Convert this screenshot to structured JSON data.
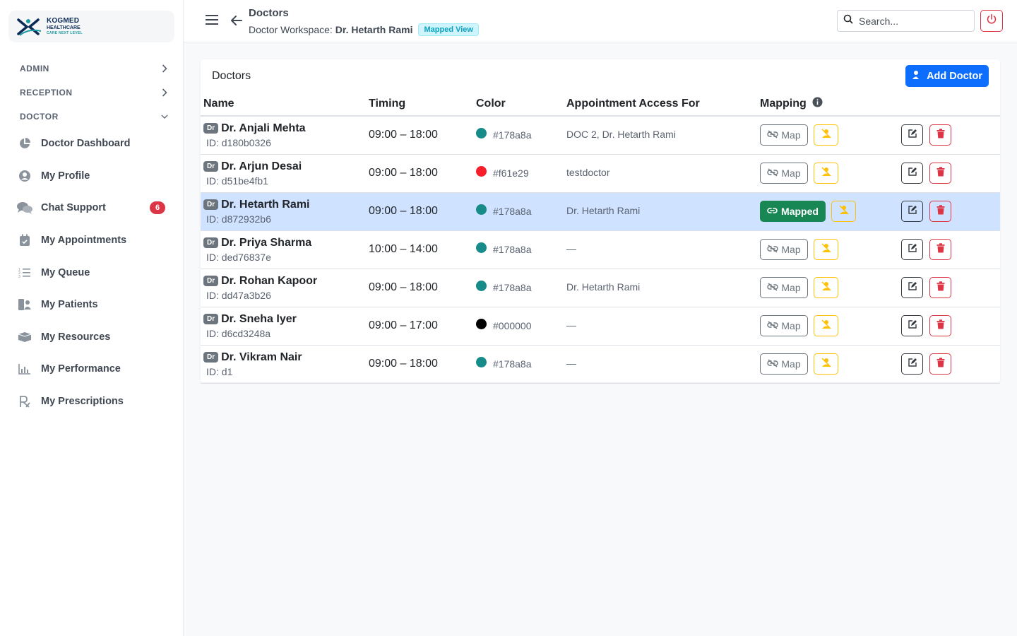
{
  "brand": {
    "name": "KOGMED",
    "sub": "HEALTHCARE",
    "tagline": "CARE NEXT LEVEL"
  },
  "sidebar": {
    "sections": [
      {
        "label": "ADMIN",
        "icon": "chevron-right-icon"
      },
      {
        "label": "RECEPTION",
        "icon": "chevron-right-icon"
      },
      {
        "label": "DOCTOR",
        "icon": "chevron-down-icon"
      }
    ],
    "items": [
      {
        "label": "Doctor Dashboard",
        "icon": "pie-chart-icon"
      },
      {
        "label": "My Profile",
        "icon": "user-circle-icon"
      },
      {
        "label": "Chat Support",
        "icon": "chat-icon",
        "badge": "6"
      },
      {
        "label": "My Appointments",
        "icon": "calendar-icon"
      },
      {
        "label": "My Queue",
        "icon": "list-ordered-icon"
      },
      {
        "label": "My Patients",
        "icon": "patients-icon"
      },
      {
        "label": "My Resources",
        "icon": "box-icon"
      },
      {
        "label": "My Performance",
        "icon": "bar-chart-icon"
      },
      {
        "label": "My Prescriptions",
        "icon": "prescription-icon"
      }
    ]
  },
  "header": {
    "title": "Doctors",
    "workspace_label": "Doctor Workspace:",
    "workspace_name": "Dr. Hetarth Rami",
    "view_badge": "Mapped View",
    "search_placeholder": "Search..."
  },
  "card": {
    "title": "Doctors",
    "add_button": "Add Doctor",
    "columns": [
      "Name",
      "Timing",
      "Color",
      "Appointment Access For",
      "Mapping"
    ],
    "dr_tag": "Dr",
    "map_label": "Map",
    "mapped_label": "Mapped",
    "rows": [
      {
        "name": "Dr. Anjali Mehta",
        "id": "ID: d180b0326",
        "timing": "09:00 – 18:00",
        "color": "#178a8a",
        "access": "DOC 2, Dr. Hetarth Rami",
        "mapped": false
      },
      {
        "name": "Dr. Arjun Desai",
        "id": "ID: d51be4fb1",
        "timing": "09:00 – 18:00",
        "color": "#f61e29",
        "access": "testdoctor",
        "mapped": false
      },
      {
        "name": "Dr. Hetarth Rami",
        "id": "ID: d872932b6",
        "timing": "09:00 – 18:00",
        "color": "#178a8a",
        "access": "Dr. Hetarth Rami",
        "mapped": true
      },
      {
        "name": "Dr. Priya Sharma",
        "id": "ID: ded76837e",
        "timing": "10:00 – 14:00",
        "color": "#178a8a",
        "access": "—",
        "mapped": false
      },
      {
        "name": "Dr. Rohan Kapoor",
        "id": "ID: dd47a3b26",
        "timing": "09:00 – 18:00",
        "color": "#178a8a",
        "access": "Dr. Hetarth Rami",
        "mapped": false
      },
      {
        "name": "Dr. Sneha Iyer",
        "id": "ID: d6cd3248a",
        "timing": "09:00 – 17:00",
        "color": "#000000",
        "access": "—",
        "mapped": false
      },
      {
        "name": "Dr. Vikram Nair",
        "id": "ID: d1",
        "timing": "09:00 – 18:00",
        "color": "#178a8a",
        "access": "—",
        "mapped": false
      }
    ]
  }
}
